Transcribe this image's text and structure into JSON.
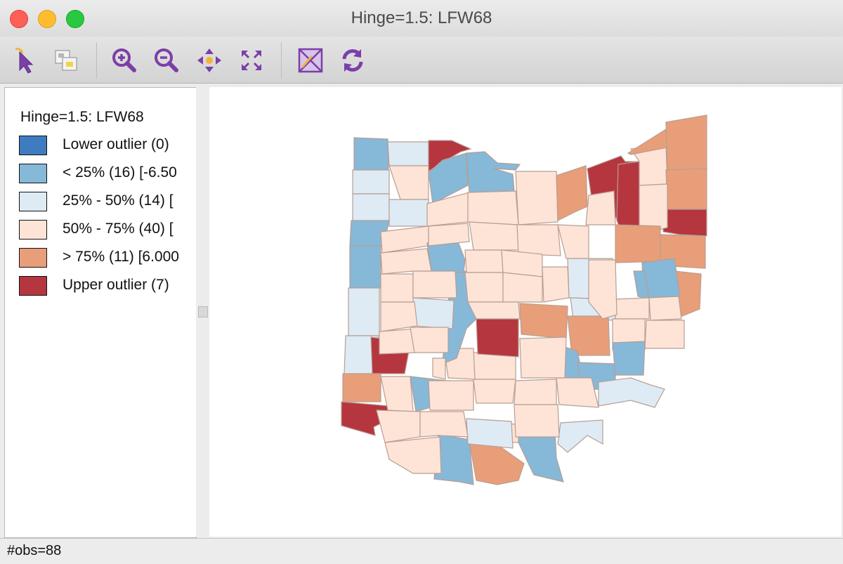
{
  "window": {
    "title": "Hinge=1.5: LFW68"
  },
  "toolbar": {
    "buttons": [
      {
        "name": "select-tool",
        "icon": "arrow-pointer-icon"
      },
      {
        "name": "copy-selection",
        "icon": "copy-map-icon"
      },
      {
        "name": "zoom-in",
        "icon": "zoom-in-icon"
      },
      {
        "name": "zoom-out",
        "icon": "zoom-out-icon"
      },
      {
        "name": "pan",
        "icon": "pan-arrows-icon"
      },
      {
        "name": "full-extent",
        "icon": "fit-extent-icon"
      },
      {
        "name": "toggle-layer",
        "icon": "map-layer-icon"
      },
      {
        "name": "refresh",
        "icon": "refresh-icon"
      }
    ]
  },
  "legend": {
    "title": "Hinge=1.5: LFW68",
    "items": [
      {
        "label": "Lower outlier (0)",
        "color": "#3f7cbf"
      },
      {
        "label": "< 25% (16)  [-6.50",
        "color": "#86b8d8"
      },
      {
        "label": "25% - 50% (14)  [",
        "color": "#deebf5"
      },
      {
        "label": "50% - 75% (40)  [",
        "color": "#fde4d6"
      },
      {
        "label": "> 75% (11)  [6.000",
        "color": "#e89e79"
      },
      {
        "label": "Upper outlier (7)",
        "color": "#b5363f"
      }
    ]
  },
  "map": {
    "stroke": "#b89e94",
    "class_colors": [
      "#3f7cbf",
      "#86b8d8",
      "#deebf5",
      "#fde4d6",
      "#e89e79",
      "#b5363f"
    ]
  },
  "status": {
    "text": "#obs=88"
  }
}
